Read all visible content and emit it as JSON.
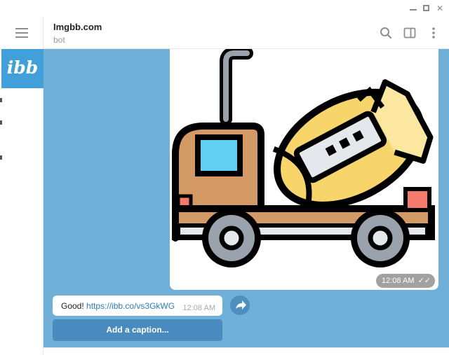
{
  "window": {
    "minimize": "",
    "maximize": "",
    "close": "✕"
  },
  "sidebar": {
    "avatar_text": "ibb"
  },
  "header": {
    "title": "Imgbb.com",
    "subtitle": "bot"
  },
  "messages": {
    "photo": {
      "time": "12:08 AM",
      "status_ticks": "✓✓",
      "image": "cement-mixer-truck"
    },
    "text_message": {
      "prefix": "Good! ",
      "link": "https://ibb.co/vs3GkWG",
      "time": "12:08 AM"
    },
    "caption_button": "Add a caption..."
  },
  "colors": {
    "chat_background": "#6fafd8",
    "accent": "#419fd9",
    "caption_button": "#4a8bbf",
    "link": "#2a7bbf"
  }
}
